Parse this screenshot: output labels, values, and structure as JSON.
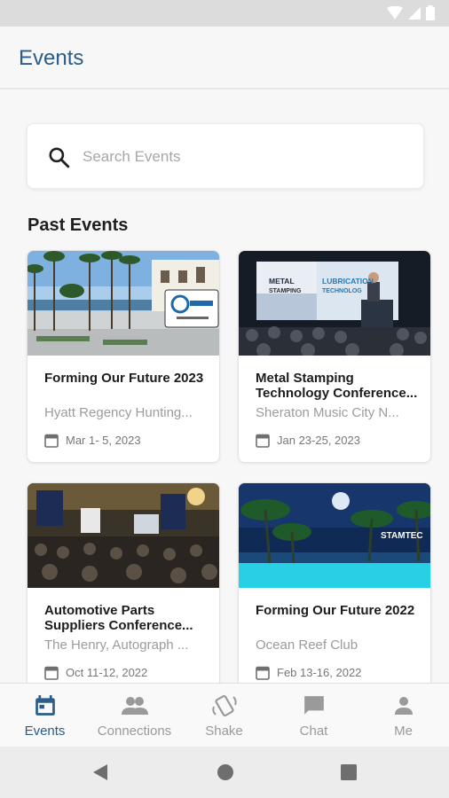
{
  "app": {
    "title": "Events"
  },
  "search": {
    "placeholder": "Search Events"
  },
  "section": {
    "title": "Past Events"
  },
  "events": [
    {
      "title": "Forming Our Future 2023",
      "venue": "Hyatt Regency Hunting...",
      "date": "Mar  1- 5, 2023",
      "image_badge": ""
    },
    {
      "title": "Metal Stamping Technology Conference...",
      "venue": "Sheraton Music City N...",
      "date": "Jan 23-25, 2023",
      "image_badge": "METAL STAMPING LUBRICATION TECHNOLOG"
    },
    {
      "title": "Automotive Parts Suppliers Conference...",
      "venue": "The Henry, Autograph ...",
      "date": "Oct 11-12, 2022",
      "image_badge": ""
    },
    {
      "title": "Forming Our Future 2022",
      "venue": "Ocean Reef Club",
      "date": "Feb 13-16, 2022",
      "image_badge": "STAMTEC"
    }
  ],
  "bottom_nav": [
    {
      "label": "Events",
      "icon": "calendar-icon",
      "active": true
    },
    {
      "label": "Connections",
      "icon": "people-icon",
      "active": false
    },
    {
      "label": "Shake",
      "icon": "shake-icon",
      "active": false
    },
    {
      "label": "Chat",
      "icon": "chat-icon",
      "active": false
    },
    {
      "label": "Me",
      "icon": "person-icon",
      "active": false
    }
  ],
  "colors": {
    "accent": "#2a5d88",
    "inactive": "#9a9a9a",
    "background": "#f7f7f8"
  }
}
